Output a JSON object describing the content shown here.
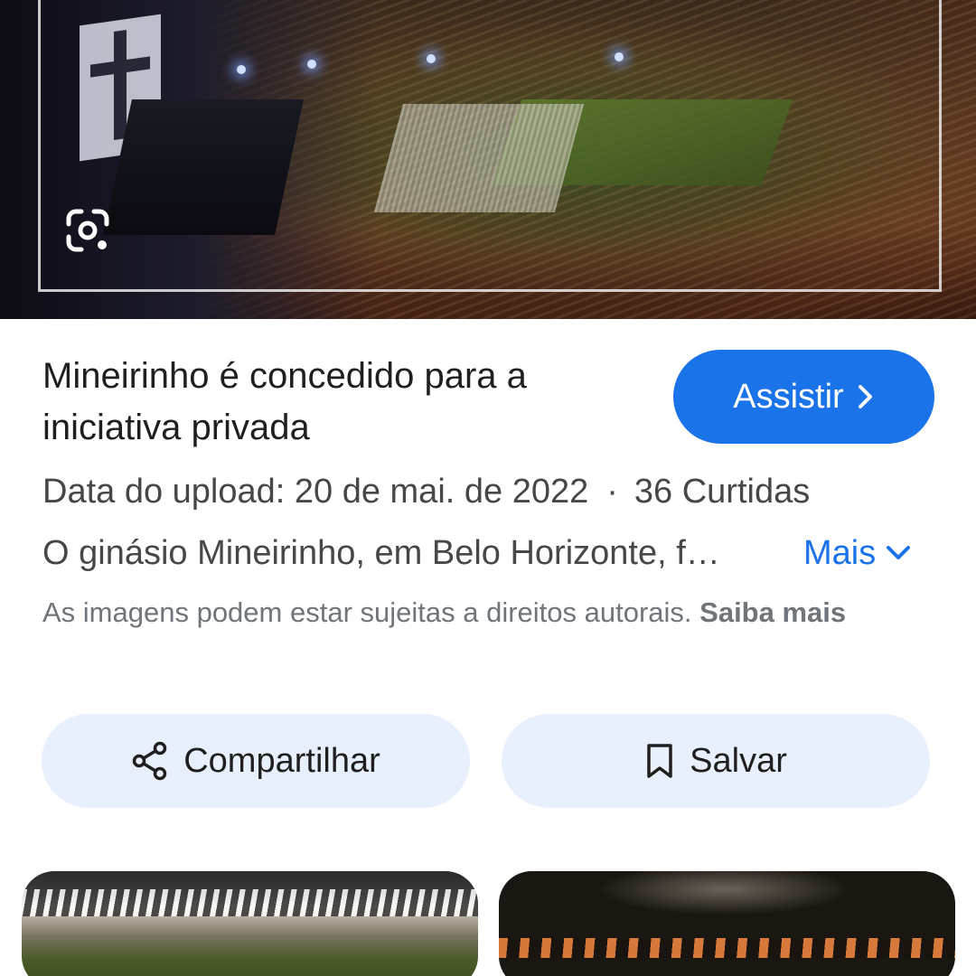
{
  "hero": {
    "alt": "Mineirinho é concedido para a iniciativa privada",
    "lens_icon": "google-lens-icon"
  },
  "result": {
    "title": "Mineirinho é concedido para a iniciativa privada",
    "watch_label": "Assistir",
    "upload_date": "Data do upload: 20 de mai. de 2022",
    "separator": "·",
    "likes": "36 Curtidas",
    "description": "O ginásio Mineirinho, em Belo Horizonte, f…",
    "more_label": "Mais",
    "copyright_text": "As imagens podem estar sujeitas a direitos autorais.",
    "learn_more": "Saiba mais"
  },
  "actions": {
    "share_label": "Compartilhar",
    "save_label": "Salvar"
  },
  "colors": {
    "accent": "#1a73e8",
    "action_bg": "#e8f0fe",
    "text_primary": "#1f1f1f",
    "text_secondary": "#474747",
    "text_muted": "#70757a"
  }
}
